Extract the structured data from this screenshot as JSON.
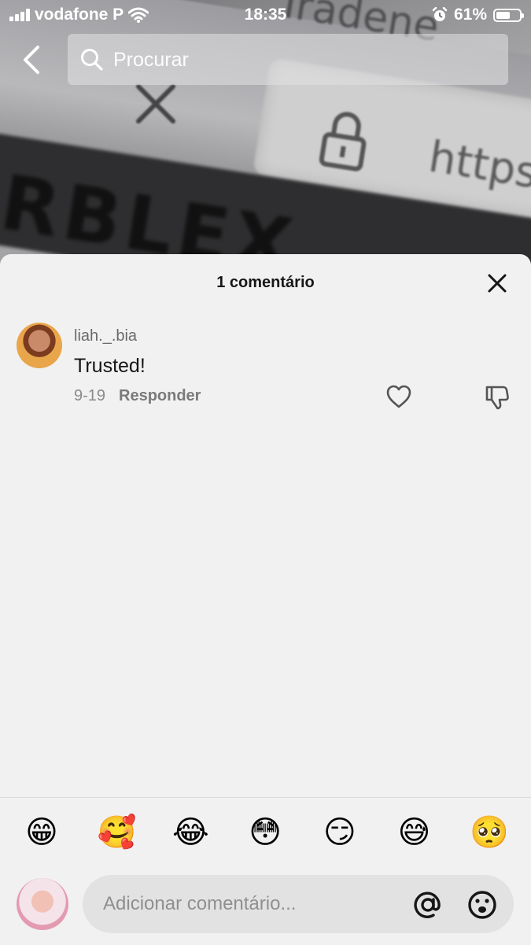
{
  "status_bar": {
    "carrier": "vodafone P",
    "time": "18:35",
    "battery_percent": "61%",
    "battery_level": 0.61
  },
  "header": {
    "search_placeholder": "Procurar"
  },
  "video_background_text": {
    "url_fragment": "https",
    "site_fragment": "Iradene",
    "logo_fragment": "RBLEX"
  },
  "comments_sheet": {
    "title": "1 comentário",
    "comments": [
      {
        "username": "liah._.bia",
        "text": "Trusted!",
        "date": "9-19",
        "reply_label": "Responder"
      }
    ]
  },
  "quick_emojis": [
    "😁",
    "🥰",
    "😂",
    "😳",
    "😏",
    "😅",
    "🥺"
  ],
  "composer": {
    "placeholder": "Adicionar comentário..."
  },
  "colors": {
    "sheet_bg": "#f1f1f1",
    "text_primary": "#161616",
    "text_secondary": "#8a8a8a",
    "input_bg": "#e2e2e2"
  }
}
